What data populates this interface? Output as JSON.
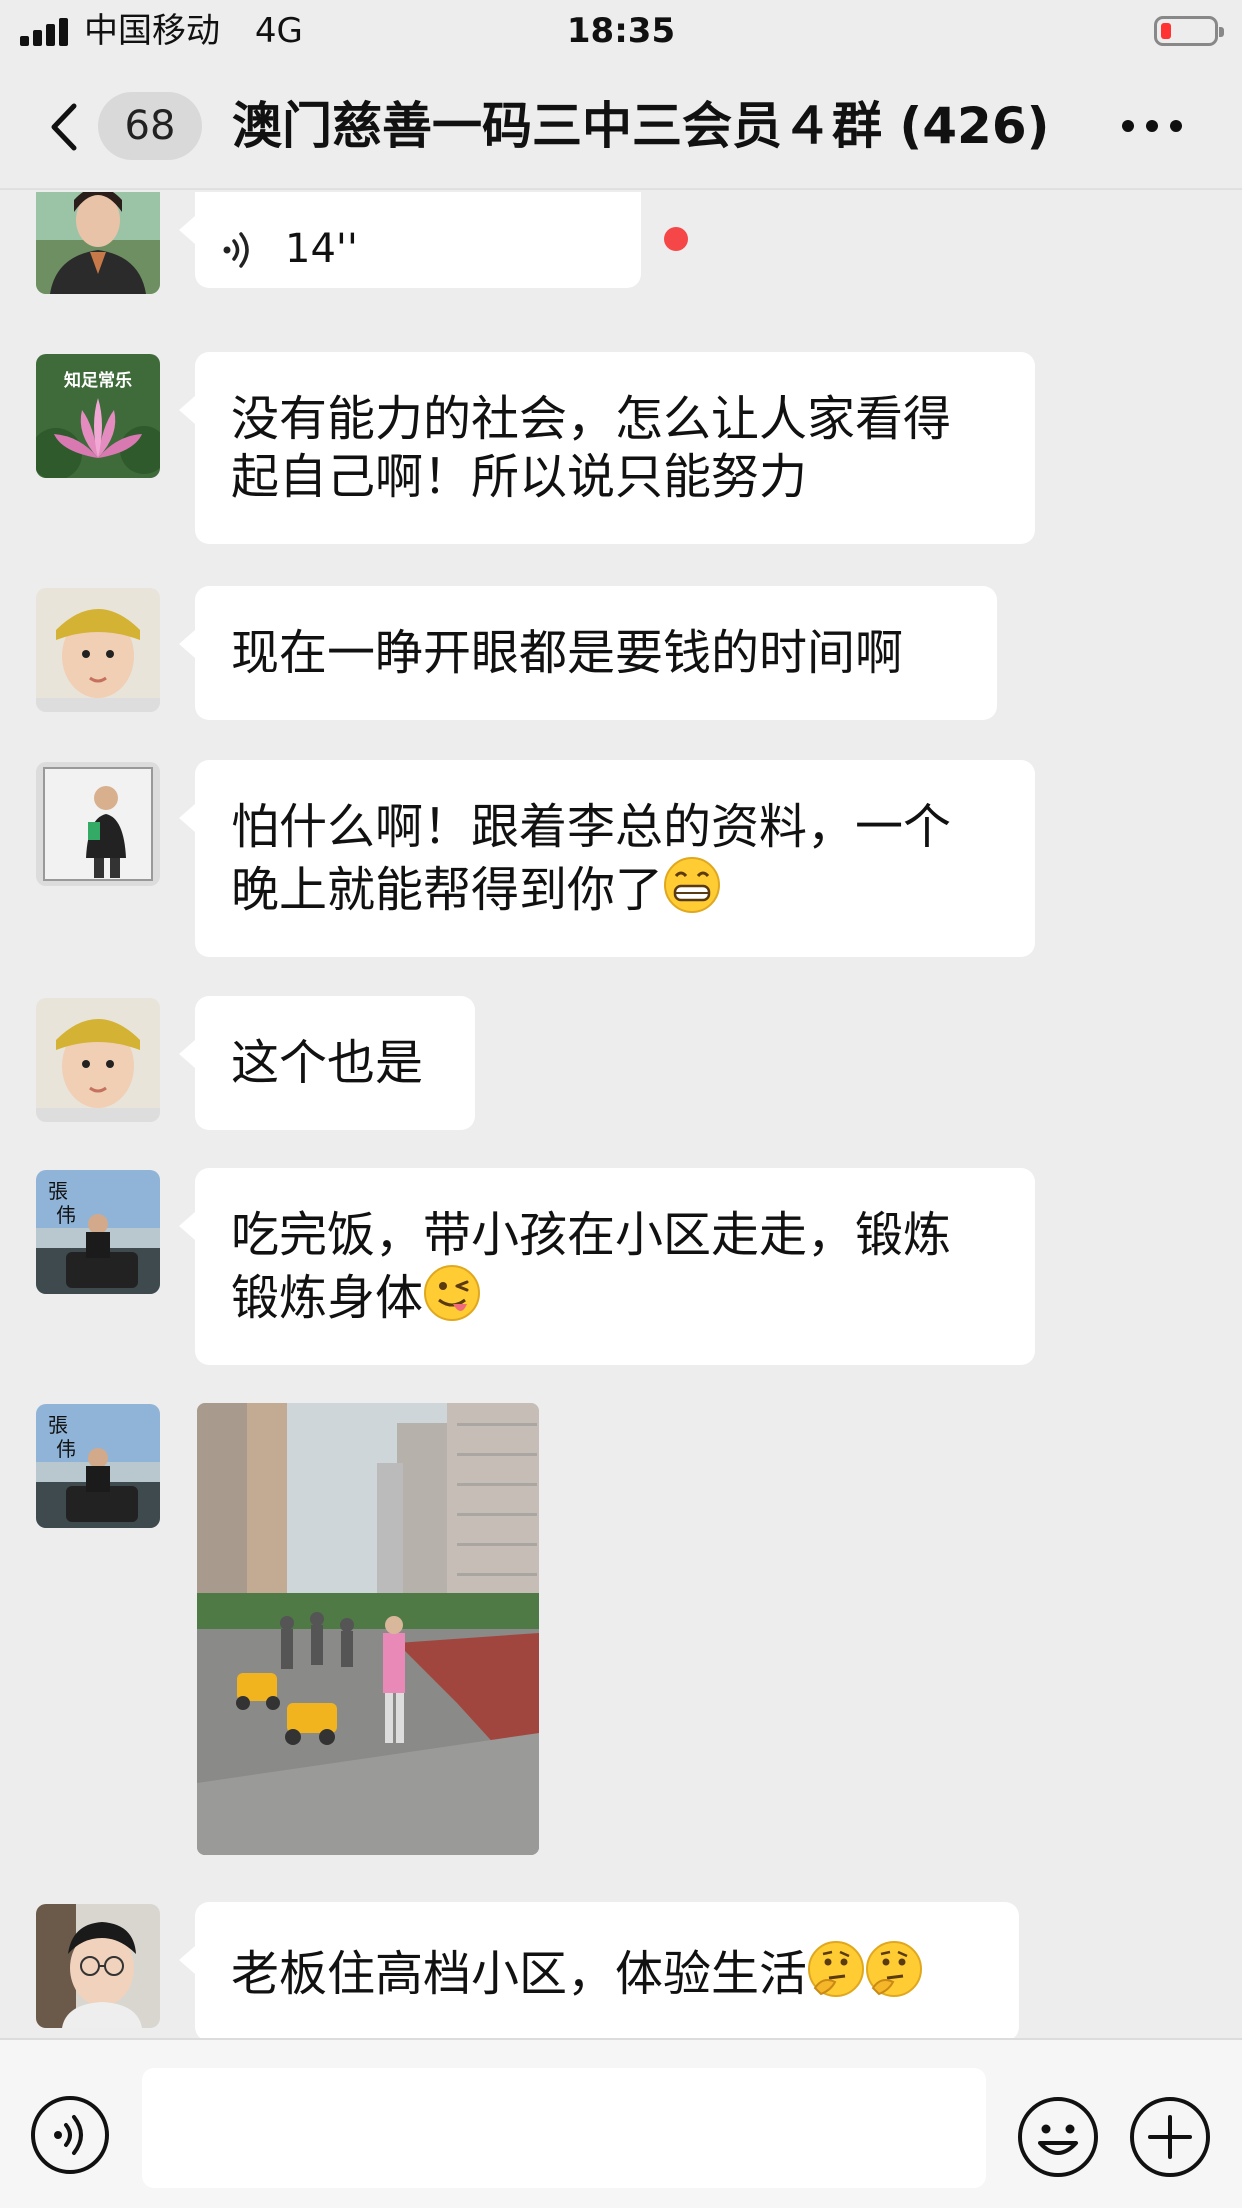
{
  "status_bar": {
    "carrier": "中国移动",
    "network": "4G",
    "time": "18:35",
    "battery_color": "#ff3b30"
  },
  "nav": {
    "back_icon": "chevron-left-icon",
    "unread_count": "68",
    "title": "澳门慈善一码三中三会员４群 (426)",
    "more_icon": "ellipsis-icon"
  },
  "messages": [
    {
      "type": "voice",
      "avatar": "avatar-woman",
      "duration": "14''",
      "unread": true
    },
    {
      "type": "text",
      "avatar": "avatar-lotus",
      "avatar_caption": "知足常乐",
      "lines": [
        "没有能力的社会，怎么让人家看得",
        "起自己啊！所以说只能努力"
      ]
    },
    {
      "type": "text",
      "avatar": "avatar-boy-hat",
      "lines": [
        "现在一睁开眼都是要钱的时间啊"
      ]
    },
    {
      "type": "text",
      "avatar": "avatar-man-mirror",
      "lines": [
        "怕什么啊！跟着李总的资料，一个",
        "晚上就能帮得到你了"
      ],
      "emoji": "grinning-face"
    },
    {
      "type": "text",
      "avatar": "avatar-boy-hat",
      "lines": [
        "这个也是"
      ]
    },
    {
      "type": "text",
      "avatar": "avatar-man-car",
      "lines": [
        "吃完饭，带小孩在小区走走，锻炼",
        "锻炼身体"
      ],
      "emoji": "winking-tongue-face"
    },
    {
      "type": "image",
      "avatar": "avatar-man-car",
      "description": "photo-courtyard-with-children"
    },
    {
      "type": "text",
      "avatar": "avatar-young-man",
      "lines": [
        "老板住高档小区，体验生活"
      ],
      "emoji": "thinking-face-x2"
    }
  ],
  "input_bar": {
    "voice_icon": "voice-mode-icon",
    "text_value": "",
    "emoji_icon": "smiley-icon",
    "plus_icon": "plus-circle-icon"
  },
  "colors": {
    "background": "#ededed",
    "bubble": "#ffffff",
    "unread_dot": "#f54747"
  }
}
